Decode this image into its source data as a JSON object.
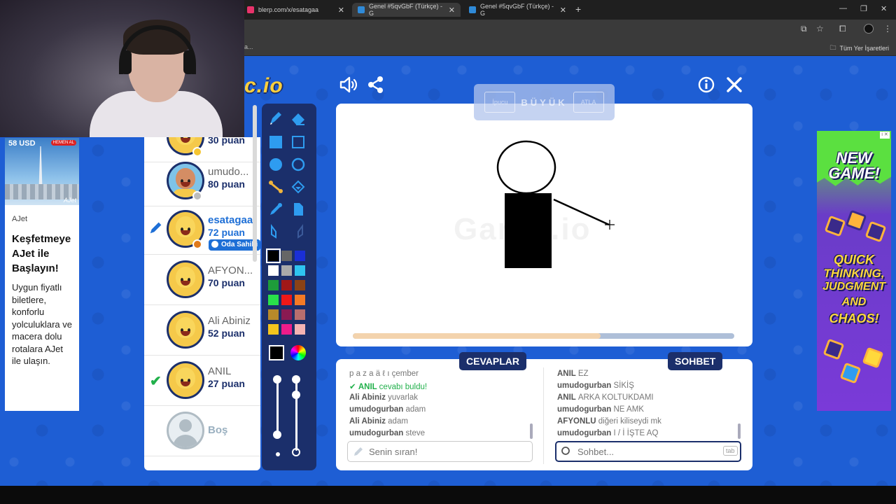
{
  "browser": {
    "tabs": [
      {
        "title": "blerp.com/x/esatagaa",
        "fav_color": "#e8336b"
      },
      {
        "title": "Genel #5qvGbF (Türkçe) - G",
        "fav_color": "#2f8ad8"
      },
      {
        "title": "Genel #5qvGbF (Türkçe) - G",
        "fav_color": "#2f8ad8"
      }
    ],
    "new_tab": "+",
    "bookmark_left": "a...",
    "bookmarks_label": "Tüm Yer İşaretleri"
  },
  "webcam": {},
  "ad_left": {
    "price": "58 USD",
    "cta": "HEMEN AL",
    "brand": "AJet",
    "source": "AJet",
    "title": "Keşfetmeye AJet ile Başlayın!",
    "body": "Uygun fiyatlı biletlere, konforlu yolculuklara ve macera dolu rotalara AJet ile ulaşın."
  },
  "game": {
    "logo": "c.io",
    "word_hint": {
      "left": "İpucu",
      "word": "BÜYÜK",
      "right": "ATLA"
    },
    "watermark": "Gartic.io",
    "progress": 0.65,
    "players": [
      {
        "name": "",
        "score": "30 puan",
        "avatar": "yellow",
        "badge_color": "#f5c531"
      },
      {
        "name": "umudo...",
        "score": "80 puan",
        "avatar": "brown",
        "badge_color": "#bdbdbd"
      },
      {
        "name": "esatagaa",
        "score": "72 puan",
        "avatar": "yellow",
        "badge_color": "#e07a1b",
        "self": true,
        "owner_tag": "Oda Sahibi"
      },
      {
        "name": "AFYON...",
        "score": "70 puan",
        "avatar": "yellow"
      },
      {
        "name": "Ali Abiniz",
        "score": "52 puan",
        "avatar": "yellow"
      },
      {
        "name": "ANIL",
        "score": "27 puan",
        "avatar": "yellow",
        "guessed": true
      },
      {
        "name": "Boş",
        "score": "",
        "avatar": "empty"
      }
    ],
    "colors": [
      "#000000",
      "#666666",
      "#1a2fd6",
      "#ffffff",
      "#aaaaaa",
      "#2ec4f0",
      "#1e9c3a",
      "#a01818",
      "#8a4216",
      "#29e04a",
      "#ee1818",
      "#f57a25",
      "#b88a2a",
      "#8a1a52",
      "#b86e6e",
      "#f5c51e",
      "#ee1c8a",
      "#f5b3b3"
    ],
    "answers": {
      "header": "CEVAPLAR",
      "messages": [
        {
          "user": "",
          "text": "p a z a ä ℓ ı çember"
        },
        {
          "user": "ANIL",
          "text": "cevabı buldu!",
          "success": true
        },
        {
          "user": "Ali Abiniz",
          "text": "yuvarlak"
        },
        {
          "user": "umudogurban",
          "text": "adam"
        },
        {
          "user": "Ali Abiniz",
          "text": "adam"
        },
        {
          "user": "umudogurban",
          "text": "steve"
        }
      ],
      "input_placeholder": "Senin sıran!"
    },
    "chat": {
      "header": "SOHBET",
      "messages": [
        {
          "user": "ANIL",
          "text": "EZ"
        },
        {
          "user": "umudogurban",
          "text": "SİKİŞ"
        },
        {
          "user": "ANIL",
          "text": "ARKA KOLTUKDAMI"
        },
        {
          "user": "umudogurban",
          "text": "NE AMK"
        },
        {
          "user": "AFYONLU",
          "text": "diğeri kiliseydi mk"
        },
        {
          "user": "umudogurban",
          "text": "I / İ İŞTE AQ"
        }
      ],
      "input_placeholder": "Sohbet...",
      "tab_hint": "tab"
    }
  },
  "ad_right": {
    "line1": "NEW",
    "line2": "GAME!",
    "line3": "QUICK",
    "line4": "THINKING,",
    "line5": "JUDGMENT",
    "line6": "AND",
    "line7": "CHAOS!",
    "info": "i ✕"
  }
}
